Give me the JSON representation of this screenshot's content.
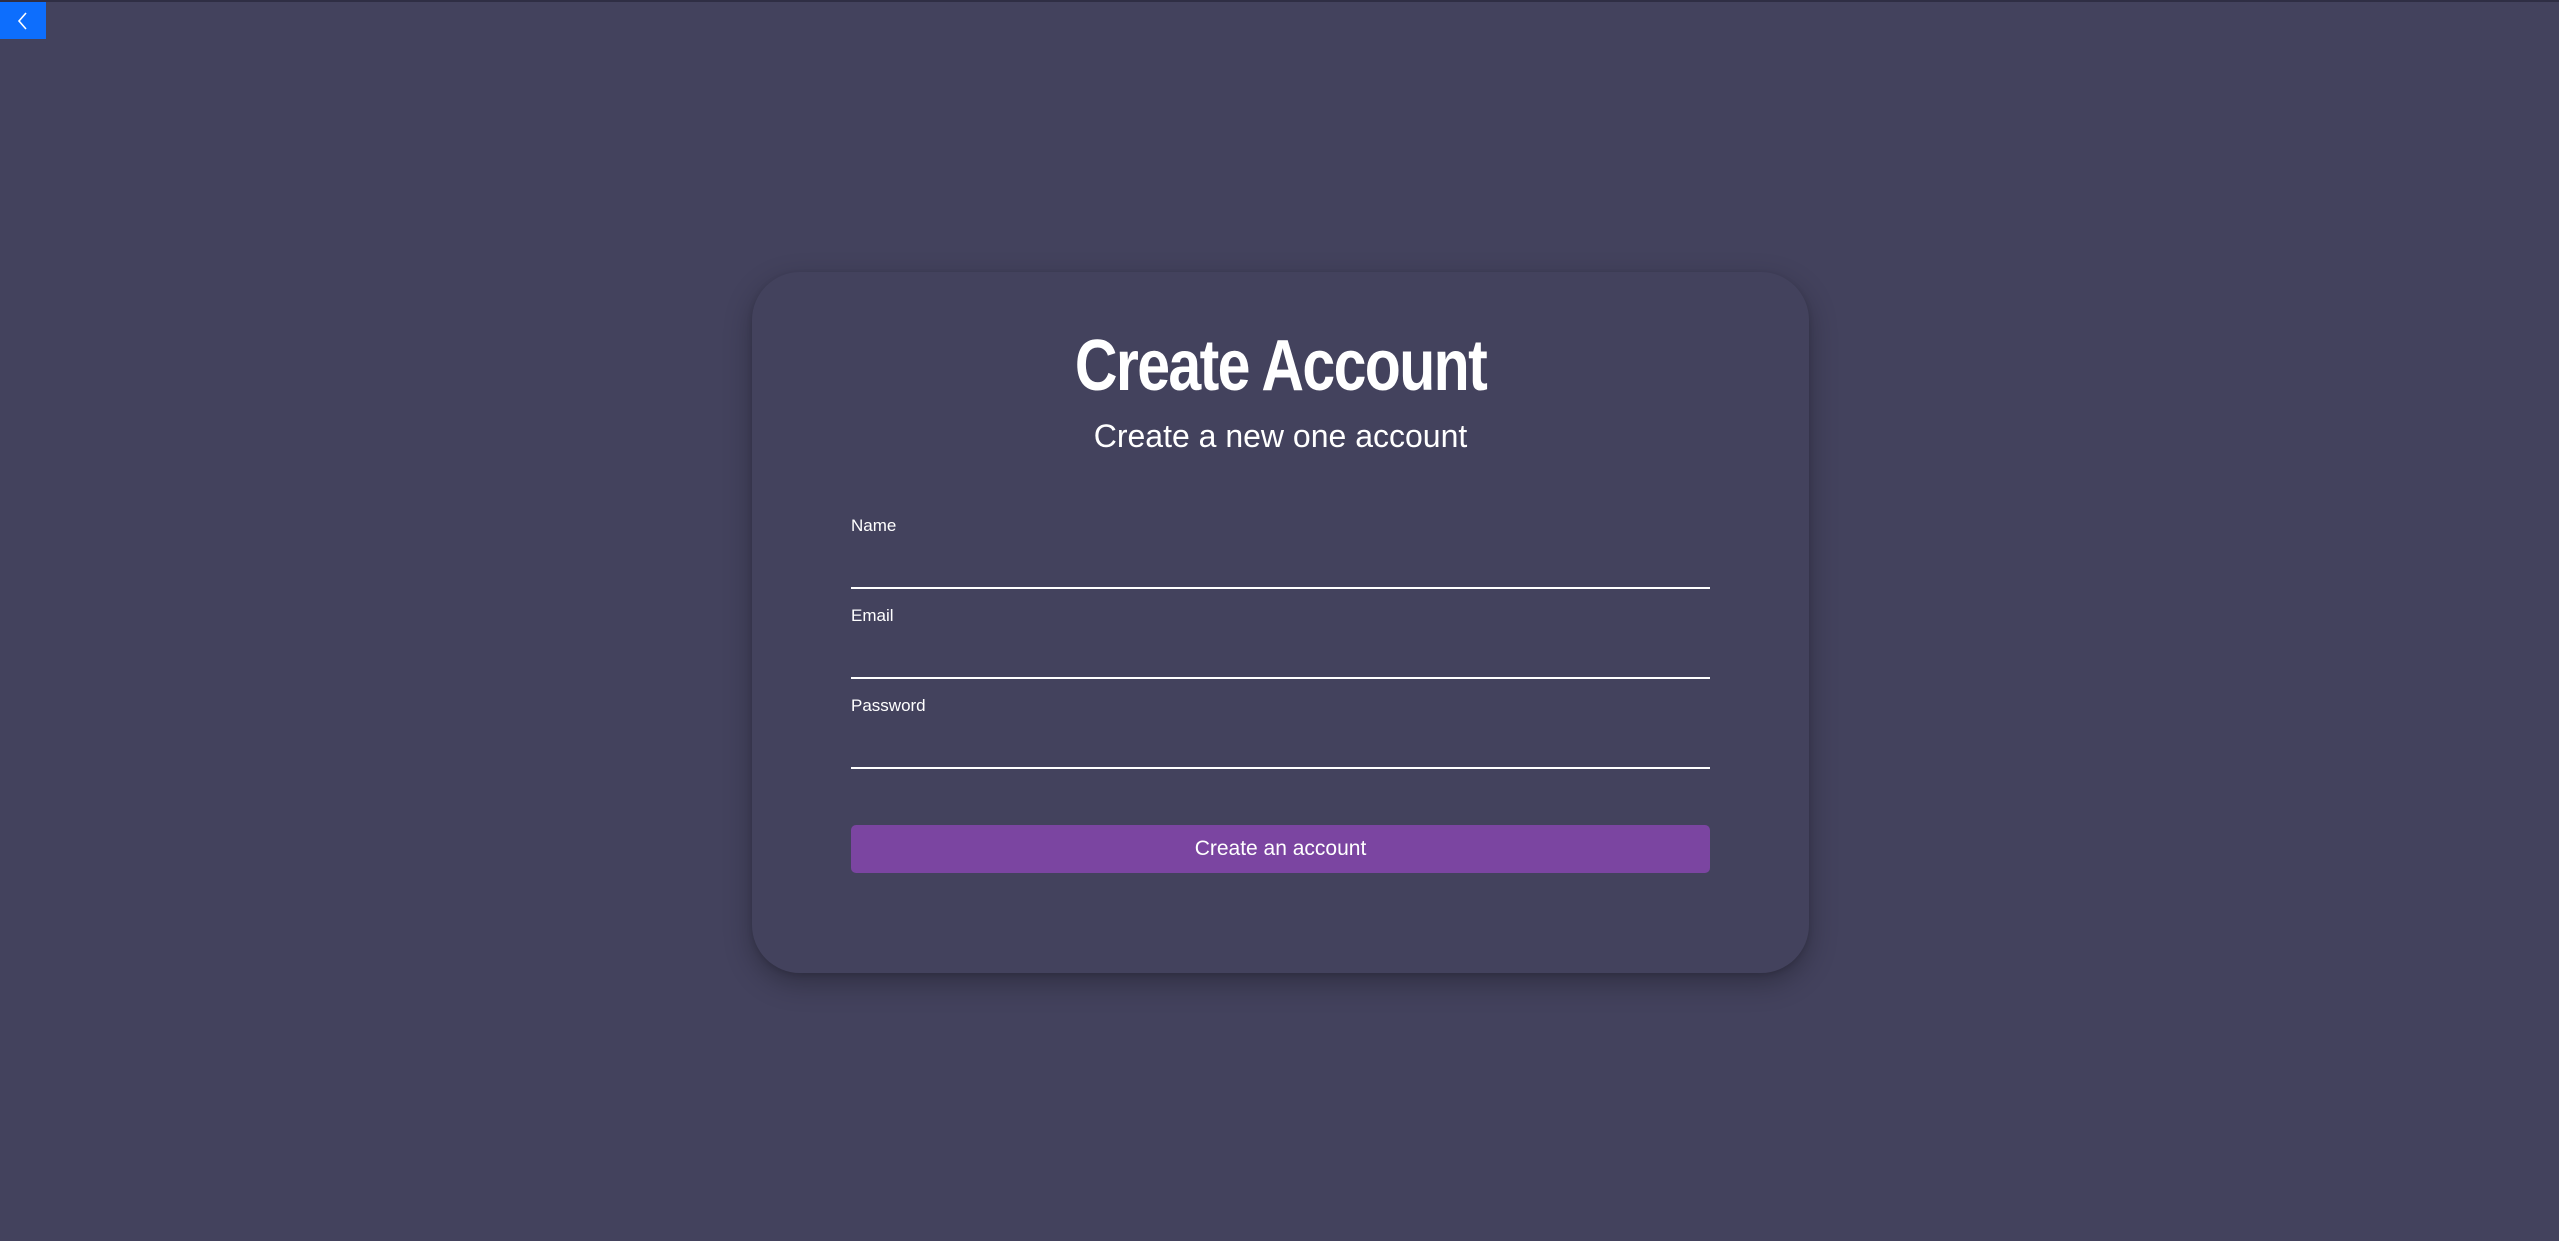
{
  "colors": {
    "background": "#43425d",
    "back_button": "#0d6efd",
    "submit_button": "#7b45a1",
    "text": "#ffffff"
  },
  "back_button": {
    "icon": "chevron-left-icon"
  },
  "form": {
    "title": "Create Account",
    "subtitle": "Create a new one account",
    "fields": [
      {
        "label": "Name",
        "value": "",
        "type": "text"
      },
      {
        "label": "Email",
        "value": "",
        "type": "email"
      },
      {
        "label": "Password",
        "value": "",
        "type": "password"
      }
    ],
    "submit_label": "Create an account"
  }
}
